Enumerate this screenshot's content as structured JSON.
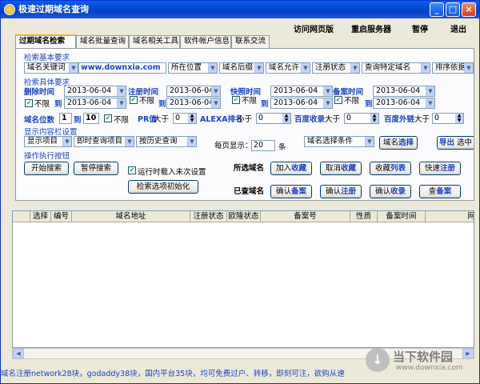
{
  "window": {
    "title": "极速过期域名查询",
    "min": "_",
    "max": "□",
    "close": "×"
  },
  "menu": [
    "访问网页版",
    "重启服务器",
    "暂停",
    "退出"
  ],
  "tabs": [
    "过期域名检索",
    "域名批量查询",
    "域名相关工具",
    "软件帐户信息",
    "联系交流"
  ],
  "sections": {
    "basic": "检索基本要求",
    "specific": "检索具体要求",
    "display": "显示内容栏设置",
    "actions": "操作执行按钮"
  },
  "basic": {
    "keyword_type": "域名关键词",
    "keyword_value": "www.downxia.com",
    "position": "所在位置",
    "suffix": "域名后缀",
    "allow": "域名允许",
    "reg_status": "注册状态",
    "query_type": "查询特定域名",
    "sort": "排序依据"
  },
  "specific": {
    "delete_time": "删除时间",
    "reg_time": "注册时间",
    "snapshot_time": "快照时间",
    "icp_time": "备案时间",
    "date": "2013-06-04",
    "to": "到",
    "unlimited": "不限",
    "digits_label": "域名位数",
    "digits_from": "1",
    "digits_to": "10",
    "pr_label": "PR值",
    "pr_cmp": "大于",
    "pr_value": "0",
    "alexa_label": "ALEXA排名",
    "alexa_cmp": "小于",
    "alexa_value": "0",
    "baidu_label": "百度收录",
    "baidu_cmp": "大于",
    "baidu_value": "0",
    "baidu_links_label": "百度外链",
    "baidu_links_cmp": "大于",
    "baidu_links_value": "0"
  },
  "display": {
    "show_items": "显示项目",
    "instant_items": "即时查询项目",
    "history": "按历史查询",
    "per_page_label": "每页显示：",
    "per_page_value": "20",
    "per_page_unit": "条",
    "select_cond": "域名选择条件",
    "select_btn_a": "域名",
    "select_btn_b": "选择",
    "export_a": "导出",
    "export_b": "选中"
  },
  "actions": {
    "start": "开始搜索",
    "pause": "暂停搜索",
    "autoload": "运行时载入未次设置",
    "reset": "检索选项初始化",
    "selected_label": "所选域名",
    "checked_label": "已查域名",
    "add_fav_a": "加入",
    "add_fav_b": "收藏",
    "cancel_fav_a": "取消",
    "cancel_fav_b": "收藏",
    "fav_list_a": "收藏",
    "fav_list_b": "列表",
    "quick_reg_a": "快速",
    "quick_reg_b": "注册",
    "confirm_icp_a": "确认",
    "confirm_icp_b": "备案",
    "confirm_reg_a": "确认",
    "confirm_reg_b": "注册",
    "confirm_idx_a": "确认",
    "confirm_idx_b": "收录",
    "check_icp_a": "查",
    "check_icp_b": "备案"
  },
  "table": {
    "columns": [
      "选择",
      "编号",
      "域名地址",
      "注册状态",
      "欧隆状态",
      "备案号",
      "性质",
      "备案时间",
      "网"
    ]
  },
  "status_bar": "域名注册network28块，godaddy38块，国内平台35块，均可免费过户、转移，即刻可注，欲购从速",
  "watermark": {
    "name": "当下软件园",
    "url": "www.downxia.com"
  }
}
